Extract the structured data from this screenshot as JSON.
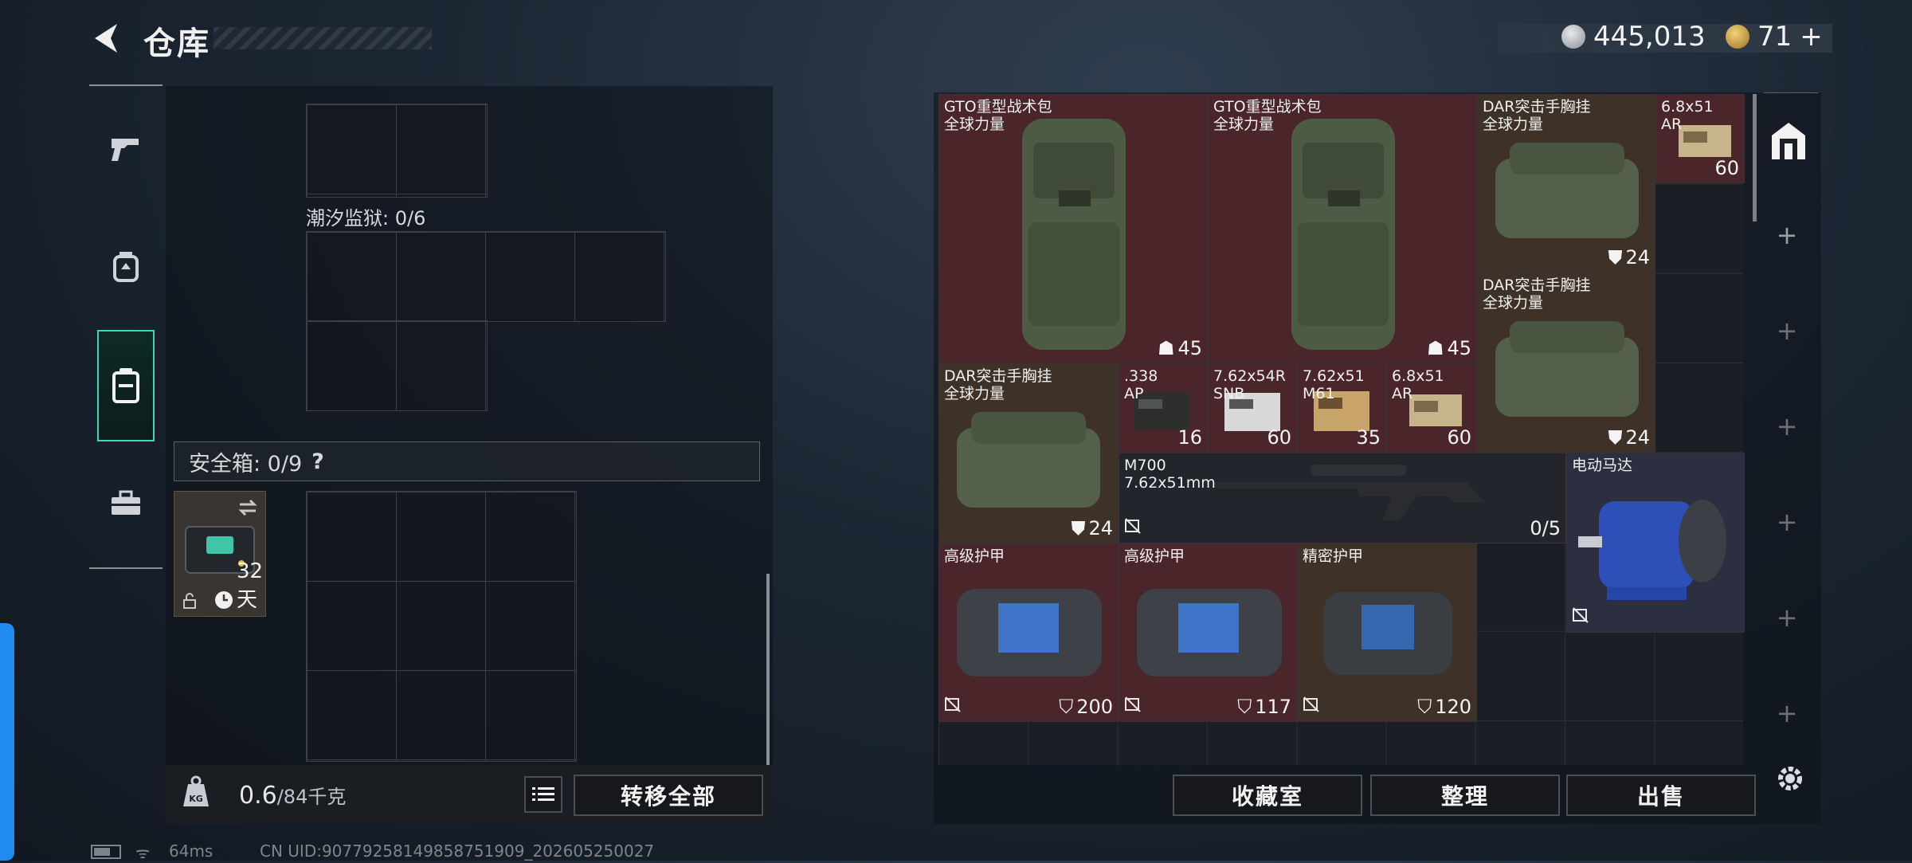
{
  "header": {
    "title": "仓库"
  },
  "currency": [
    {
      "icon": "silver-coin-icon",
      "value": "445,013",
      "color": "#b9bcc2"
    },
    {
      "icon": "gold-coin-icon",
      "value": "71",
      "suffix": "+",
      "color": "#d7a84a"
    }
  ],
  "nav": {
    "items": [
      {
        "name": "weapons",
        "icon": "pistol-icon"
      },
      {
        "name": "gear",
        "icon": "backpack-icon"
      },
      {
        "name": "storage",
        "icon": "clipboard-icon",
        "active": true
      },
      {
        "name": "toolbox",
        "icon": "toolbox-icon"
      }
    ]
  },
  "left": {
    "prison_label": "潮汐监狱: 0/6",
    "safe_box_label": "安全箱: 0/9",
    "safe_box_help": "?",
    "safe_item_days": "32天",
    "weight_value": "0.6",
    "weight_capacity": "/84千克",
    "transfer_all": "转移全部"
  },
  "inventory": {
    "items": [
      {
        "id": "gto1",
        "name": "GTO重型战术包\n全球力量",
        "count": "45",
        "color": "red"
      },
      {
        "id": "gto2",
        "name": "GTO重型战术包\n全球力量",
        "count": "45",
        "color": "red"
      },
      {
        "id": "dar1",
        "name": "DAR突击手胸挂\n全球力量",
        "count": "24",
        "color": "brown"
      },
      {
        "id": "ammo_68_top",
        "name": "6.8x51\nAR",
        "count": "60",
        "color": "red"
      },
      {
        "id": "dar2",
        "name": "DAR突击手胸挂\n全球力量",
        "count": "24",
        "color": "brown"
      },
      {
        "id": "dar3",
        "name": "DAR突击手胸挂\n全球力量",
        "count": "24",
        "color": "brown"
      },
      {
        "id": "ammo_338",
        "name": ".338\nAP",
        "count": "16",
        "color": "red"
      },
      {
        "id": "ammo_762r",
        "name": "7.62x54R\nSNB",
        "count": "60",
        "color": "red"
      },
      {
        "id": "ammo_762",
        "name": "7.62x51\nM61",
        "count": "35",
        "color": "red"
      },
      {
        "id": "ammo_68",
        "name": "6.8x51\nAR",
        "count": "60",
        "color": "red"
      },
      {
        "id": "m700",
        "name": "M700\n7.62x51mm",
        "count": "0/5",
        "color": "dark"
      },
      {
        "id": "motor",
        "name": "电动马达",
        "count": "",
        "color": "blue"
      },
      {
        "id": "armor1",
        "name": "高级护甲",
        "count": "200",
        "color": "red"
      },
      {
        "id": "armor2",
        "name": "高级护甲",
        "count": "117",
        "color": "red"
      },
      {
        "id": "armor3",
        "name": "精密护甲",
        "count": "120",
        "color": "brown"
      }
    ]
  },
  "actions": {
    "collection": "收藏室",
    "sort": "整理",
    "sell": "出售"
  },
  "footer": {
    "ping": "64ms",
    "uid": "CN UID:90779258149858751909_202605250027"
  },
  "colors": {
    "accent": "#3fd6b4",
    "red_item": "#4a2529",
    "brown_item": "#3e3228",
    "blue_item": "#2b2f40",
    "side_tab": "#1f8bf0"
  }
}
